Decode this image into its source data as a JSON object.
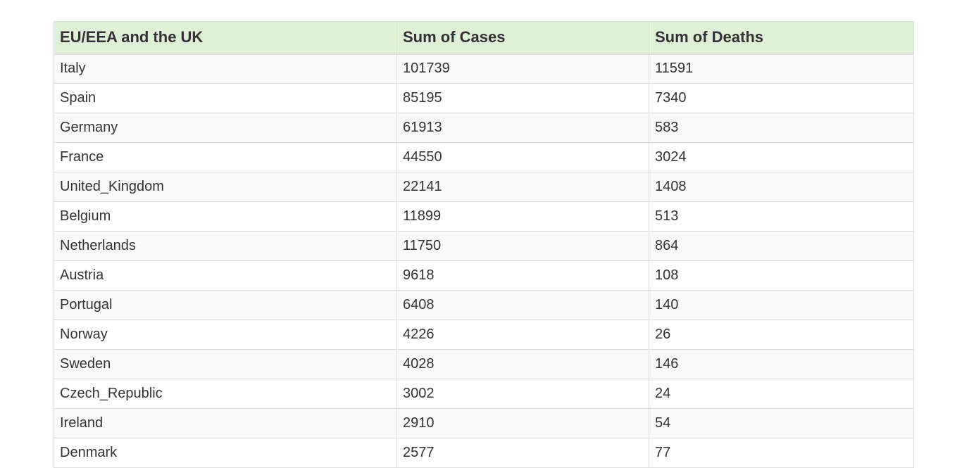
{
  "table": {
    "headers": [
      "EU/EEA and the UK",
      "Sum of Cases",
      "Sum of Deaths"
    ],
    "rows": [
      [
        "Italy",
        "101739",
        "11591"
      ],
      [
        "Spain",
        "85195",
        "7340"
      ],
      [
        "Germany",
        "61913",
        "583"
      ],
      [
        "France",
        "44550",
        "3024"
      ],
      [
        "United_Kingdom",
        "22141",
        "1408"
      ],
      [
        "Belgium",
        "11899",
        "513"
      ],
      [
        "Netherlands",
        "11750",
        "864"
      ],
      [
        "Austria",
        "9618",
        "108"
      ],
      [
        "Portugal",
        "6408",
        "140"
      ],
      [
        "Norway",
        "4226",
        "26"
      ],
      [
        "Sweden",
        "4028",
        "146"
      ],
      [
        "Czech_Republic",
        "3002",
        "24"
      ],
      [
        "Ireland",
        "2910",
        "54"
      ],
      [
        "Denmark",
        "2577",
        "77"
      ]
    ]
  },
  "colors": {
    "header_bg": "#dff0d8",
    "stripe_bg": "#f9f9f9",
    "border": "#dddddd",
    "text": "#333333"
  }
}
